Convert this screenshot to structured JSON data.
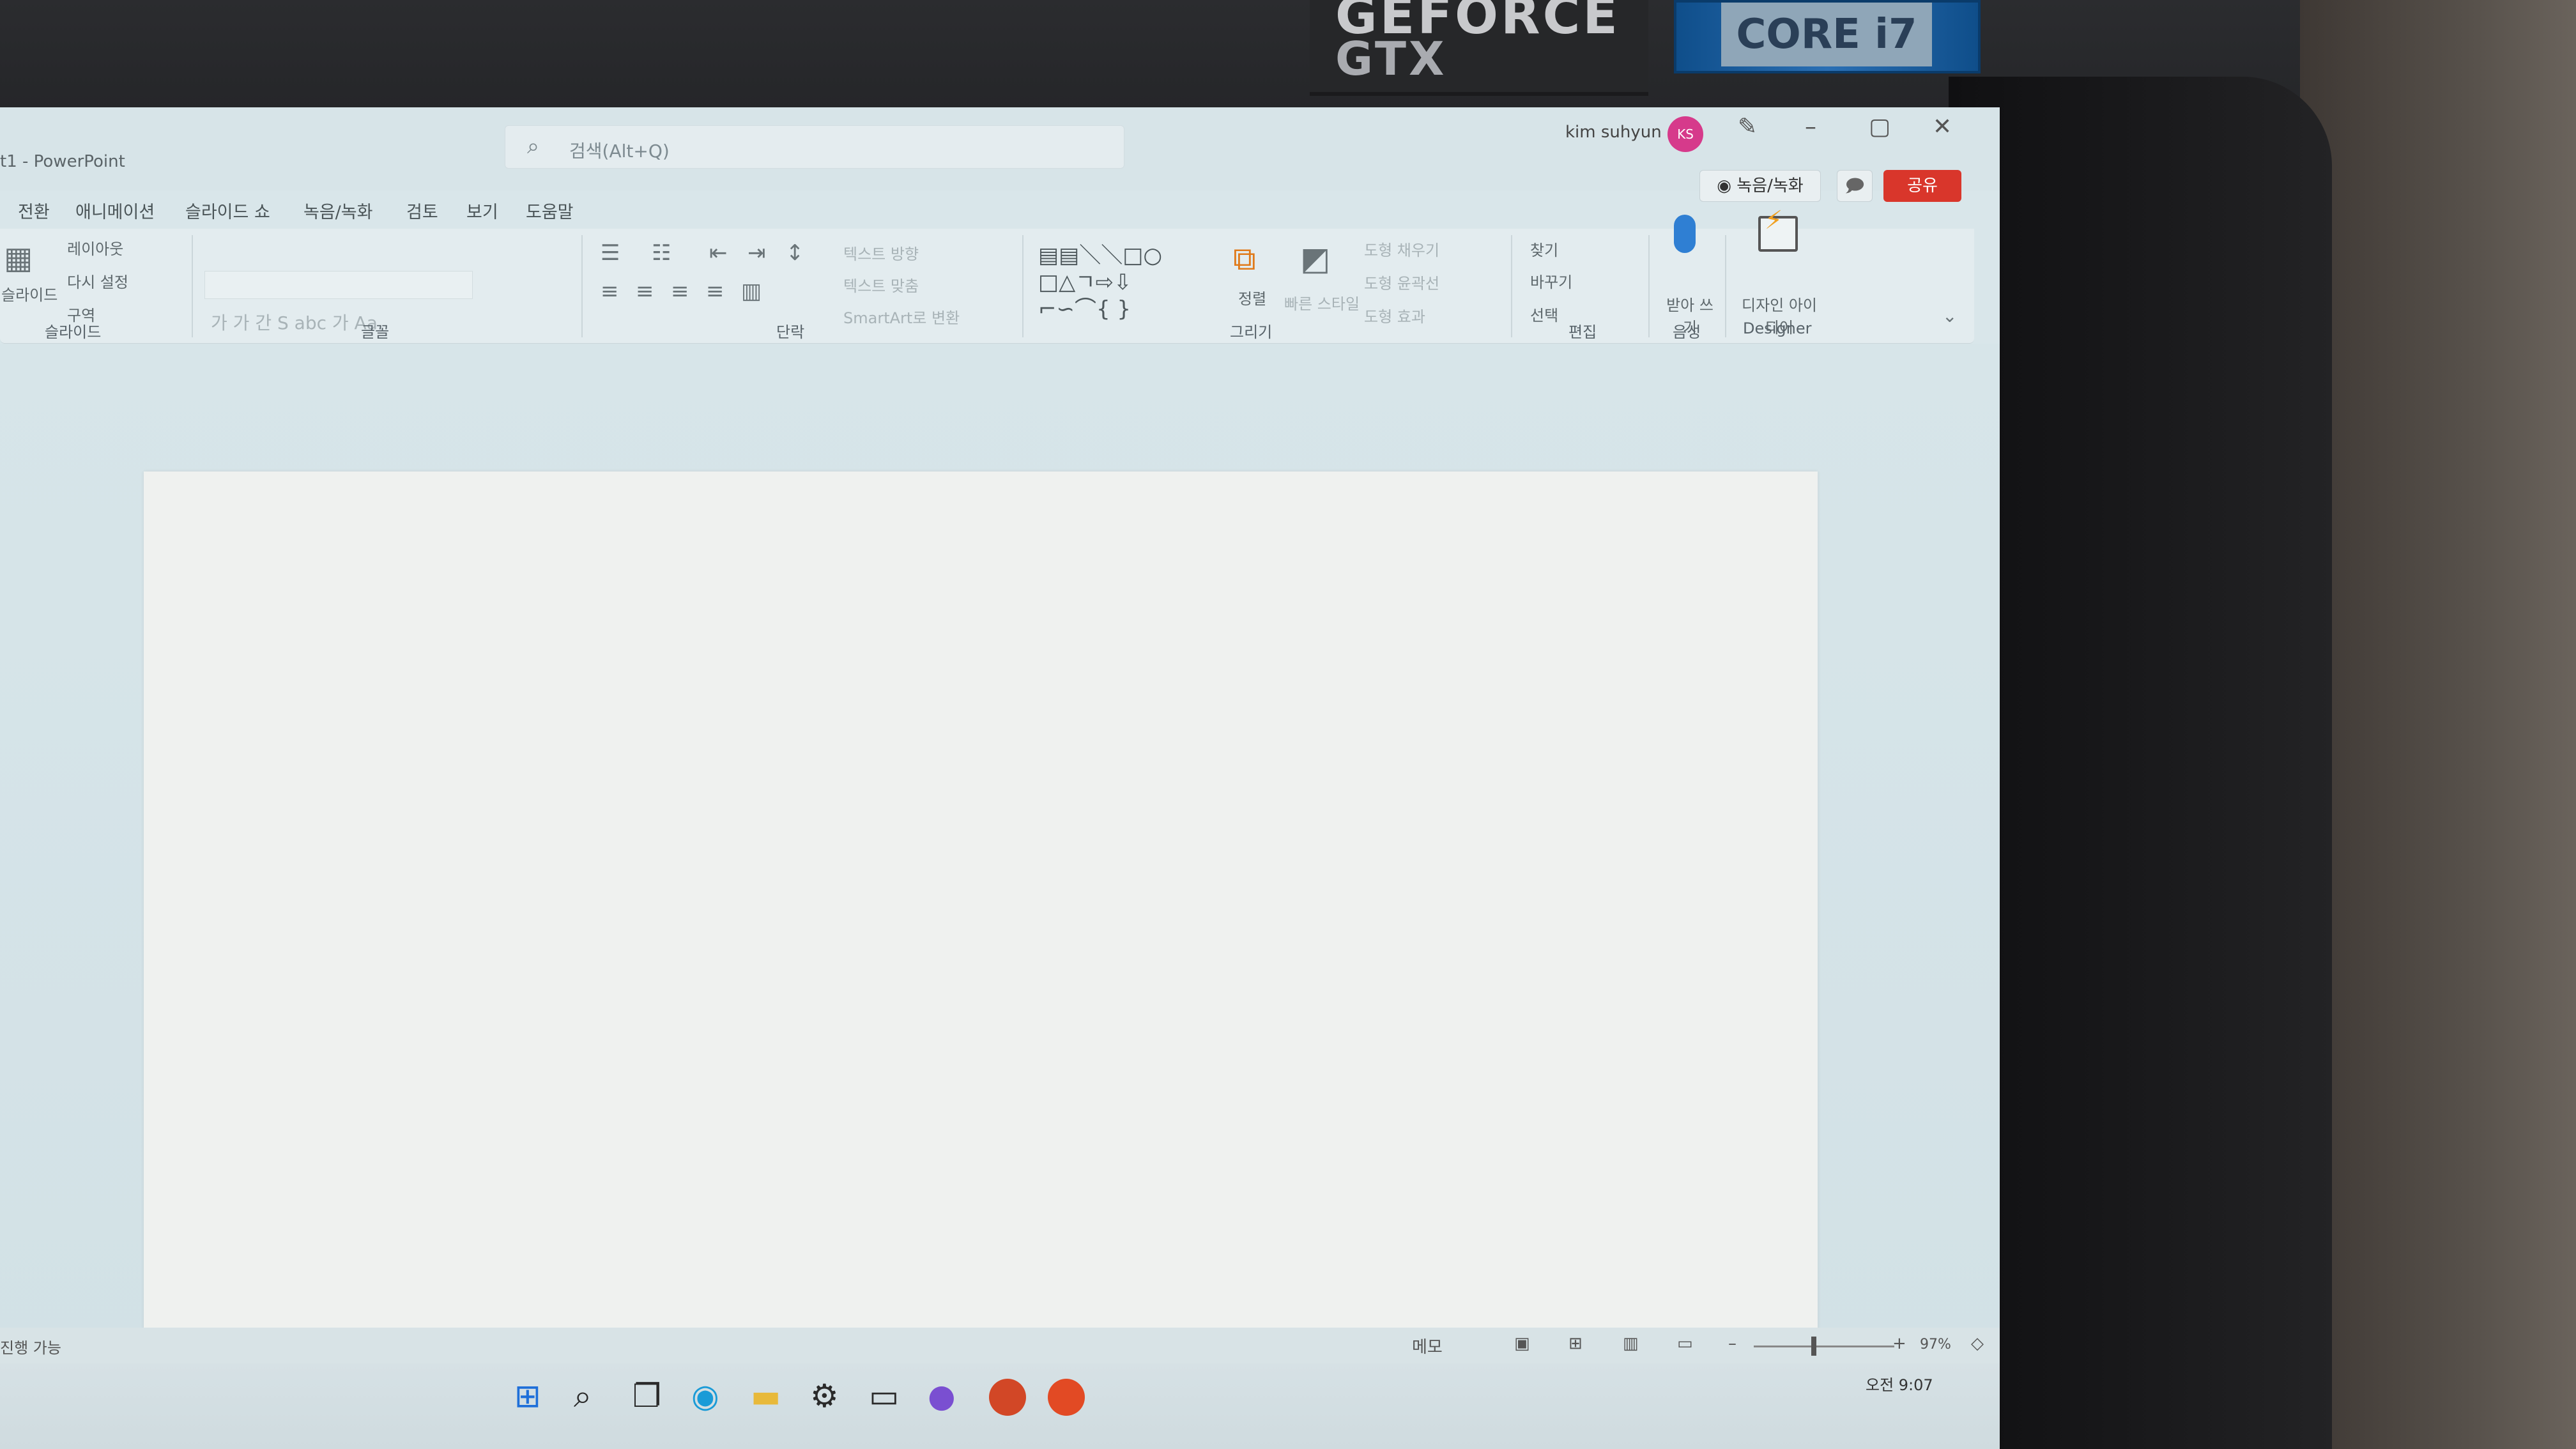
{
  "environment": {
    "sticker_gtx_line1": "GEFORCE",
    "sticker_gtx_line2": "GTX",
    "sticker_cpu": "CORE i7"
  },
  "window": {
    "title": "t1 - PowerPoint",
    "search_placeholder": "검색(Alt+Q)",
    "user_name": "kim suhyun",
    "user_initials": "KS",
    "minimize": "–",
    "restore": "▢",
    "close": "✕"
  },
  "menu": {
    "tabs": [
      "전환",
      "애니메이션",
      "슬라이드 쇼",
      "녹음/녹화",
      "검토",
      "보기",
      "도움말"
    ],
    "record_button": "◉ 녹음/녹화",
    "comment_button": "🗩",
    "share_button": "공유"
  },
  "ribbon": {
    "slides_group": {
      "new_slide": "슬라이드",
      "layout": "레이아웃",
      "reset": "다시 설정",
      "section": "구역",
      "label": "슬라이드"
    },
    "font_group": {
      "label": "글꼴"
    },
    "paragraph_group": {
      "text_direction": "텍스트 방향",
      "align_text": "텍스트 맞춤",
      "smartart": "SmartArt로 변환",
      "label": "단락"
    },
    "drawing_group": {
      "arrange": "정렬",
      "quick_styles": "빠른 스타일",
      "shape_fill": "도형 채우기",
      "shape_outline": "도형 윤곽선",
      "shape_effects": "도형 효과",
      "label": "그리기"
    },
    "editing_group": {
      "find": "찾기",
      "replace": "바꾸기",
      "select": "선택",
      "label": "편집"
    },
    "voice_group": {
      "dictate": "받아 쓰기",
      "label": "음성"
    },
    "designer_group": {
      "design_ideas": "디자인 아이디어",
      "label": "Designer"
    }
  },
  "statusbar": {
    "accessibility": "진행 가능",
    "notes": "메모",
    "zoom": "97%"
  },
  "taskbar": {
    "clock": "오전 9:07"
  }
}
